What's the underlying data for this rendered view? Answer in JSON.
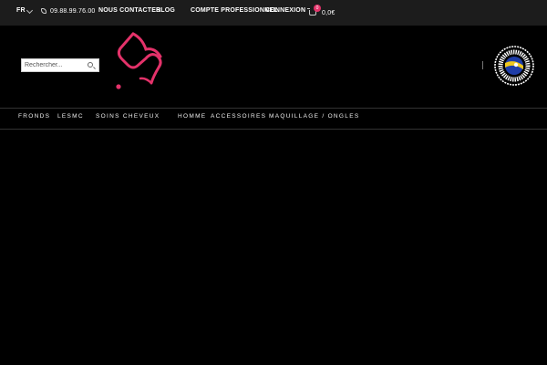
{
  "topbar": {
    "language": "FR",
    "phone": "09.88.99.76.00",
    "contact_label": "NOUS CONTACTER",
    "blog_label": "BLOG",
    "pro_account_label": "COMPTE PROFESSIONNEL",
    "login_label": "CONNEXION",
    "cart_count": "0",
    "cart_total": "0,0€"
  },
  "search": {
    "placeholder": "Rechercher..."
  },
  "nav": {
    "items": [
      {
        "label": "FRONDS"
      },
      {
        "label": "LESMC"
      },
      {
        "label": "SOINS CHEVEUX"
      },
      {
        "label": "HOMME"
      },
      {
        "label": "ACCESSOIRES"
      },
      {
        "label": "MAQUILLAGE / ONGLES"
      }
    ]
  },
  "colors": {
    "accent": "#e4326a",
    "topbar_bg": "#1c1c1c",
    "background": "#000000"
  }
}
